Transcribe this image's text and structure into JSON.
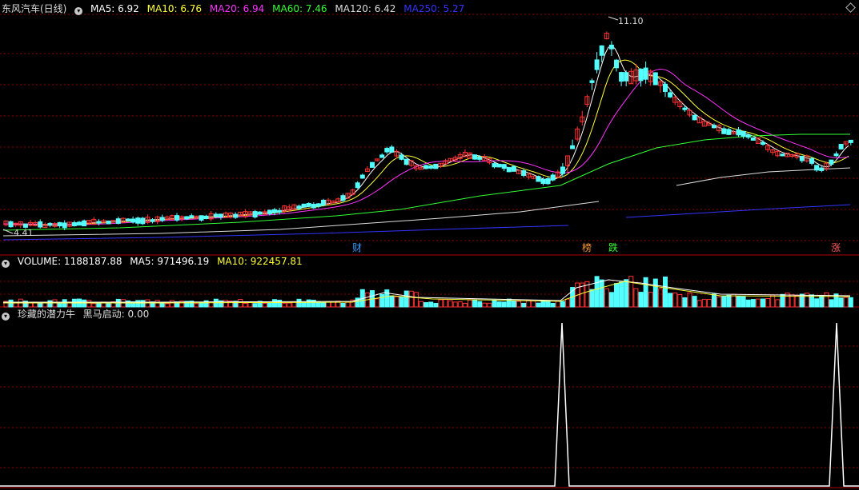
{
  "header": {
    "title": "东风汽车(日线)",
    "ma_items": [
      {
        "label": "MA5: 6.92",
        "color": "#ffffff"
      },
      {
        "label": "MA10: 6.76",
        "color": "#ffff33"
      },
      {
        "label": "MA20: 6.94",
        "color": "#ff33ff"
      },
      {
        "label": "MA60: 7.46",
        "color": "#33ff33"
      },
      {
        "label": "MA120: 6.42",
        "color": "#dddddd"
      },
      {
        "label": "MA250: 5.27",
        "color": "#3333ff"
      }
    ]
  },
  "price_panel": {
    "high_label": "11.10",
    "low_label": "4.41",
    "events": [
      {
        "label": "财",
        "color": "#3399ff"
      },
      {
        "label": "榜",
        "color": "#ff9933"
      },
      {
        "label": "跌",
        "color": "#33ff33"
      },
      {
        "label": "涨",
        "color": "#ff5555"
      }
    ]
  },
  "volume_panel": {
    "items": [
      {
        "label": "VOLUME: 1188187.88",
        "color": "#ffffff"
      },
      {
        "label": "MA5: 971496.19",
        "color": "#ffffff"
      },
      {
        "label": "MA10: 922457.81",
        "color": "#ffff33"
      }
    ]
  },
  "indicator_panel": {
    "name": "珍藏的潜力牛",
    "value_label": "黑马启动: 0.00"
  },
  "colors": {
    "up": "#ff3232",
    "down": "#54ffff",
    "grid": "#8b0000",
    "border": "#b00000"
  }
}
